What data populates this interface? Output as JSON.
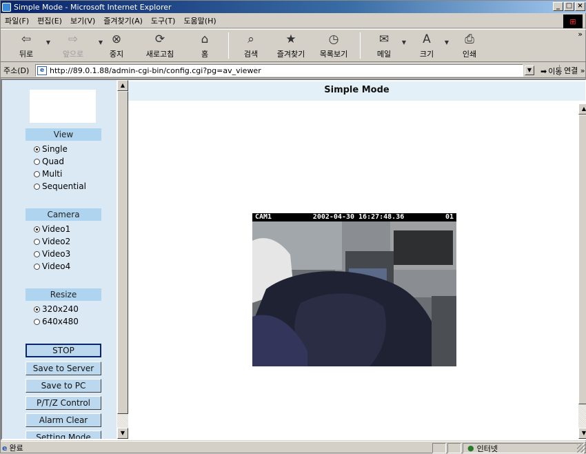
{
  "window": {
    "title": "Simple Mode - Microsoft Internet Explorer",
    "min_glyph": "_",
    "max_glyph": "□",
    "close_glyph": "×"
  },
  "menu": [
    "파일(F)",
    "편집(E)",
    "보기(V)",
    "즐겨찾기(A)",
    "도구(T)",
    "도움말(H)"
  ],
  "toolbar": {
    "back": "뒤로",
    "forward": "앞으로",
    "stop": "중지",
    "refresh": "새로고침",
    "home": "홈",
    "search": "검색",
    "favorites": "즐겨찾기",
    "history": "목록보기",
    "mail": "메일",
    "size": "크기",
    "print": "인쇄",
    "more": "»"
  },
  "address": {
    "label": "주소(D)",
    "url": "http://89.0.1.88/admin-cgi-bin/config.cgi?pg=av_viewer",
    "go": "이동",
    "links": "연결 »"
  },
  "page": {
    "title": "Simple Mode",
    "view": {
      "header": "View",
      "options": [
        "Single",
        "Quad",
        "Multi",
        "Sequential"
      ],
      "selected": 0
    },
    "camera": {
      "header": "Camera",
      "options": [
        "Video1",
        "Video2",
        "Video3",
        "Video4"
      ],
      "selected": 0
    },
    "resize": {
      "header": "Resize",
      "options": [
        "320x240",
        "640x480"
      ],
      "selected": 0
    },
    "buttons": [
      "STOP",
      "Save to Server",
      "Save to PC",
      "P/T/Z Control",
      "Alarm Clear",
      "Setting Mode"
    ],
    "video": {
      "cam": "CAM1",
      "timestamp": "2002-04-30 16:27:48.36",
      "channel": "01"
    }
  },
  "status": {
    "text": "완료",
    "zone": "인터넷"
  }
}
